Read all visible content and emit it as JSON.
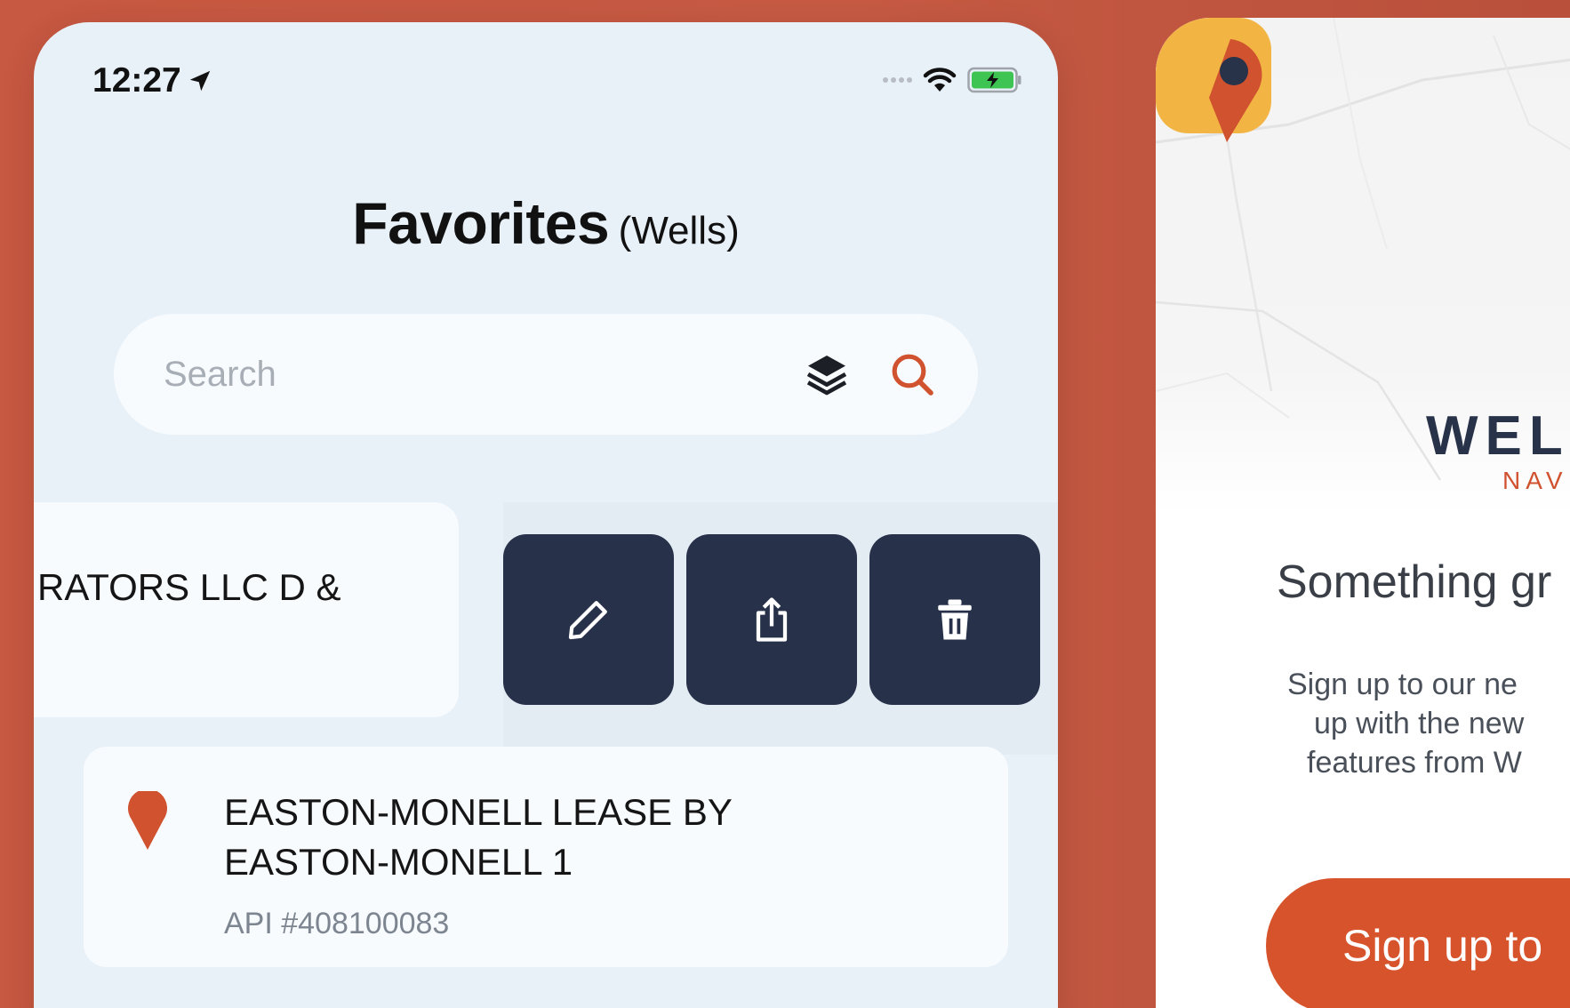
{
  "status_bar": {
    "time": "12:27"
  },
  "favorites": {
    "title": "Favorites",
    "subtitle": "(Wells)"
  },
  "search": {
    "placeholder": "Search"
  },
  "list": {
    "swiped_row_text": "RATORS LLC D &",
    "actions": [
      "edit",
      "share",
      "delete"
    ],
    "items": [
      {
        "title_line1": "EASTON-MONELL LEASE BY",
        "title_line2": "EASTON-MONELL 1",
        "api": "API #408100083"
      }
    ]
  },
  "promo": {
    "logo_word": "WELL",
    "logo_sub": "NAVI",
    "headline": "Something gr",
    "body_line1": "Sign up to our ne",
    "body_line2": "up with the new",
    "body_line3": "features from W",
    "button_label": "Sign up to"
  },
  "colors": {
    "background": "#c85a42",
    "accent": "#d7532c",
    "action_bg": "#27324a",
    "surface": "#e8f0f8"
  }
}
